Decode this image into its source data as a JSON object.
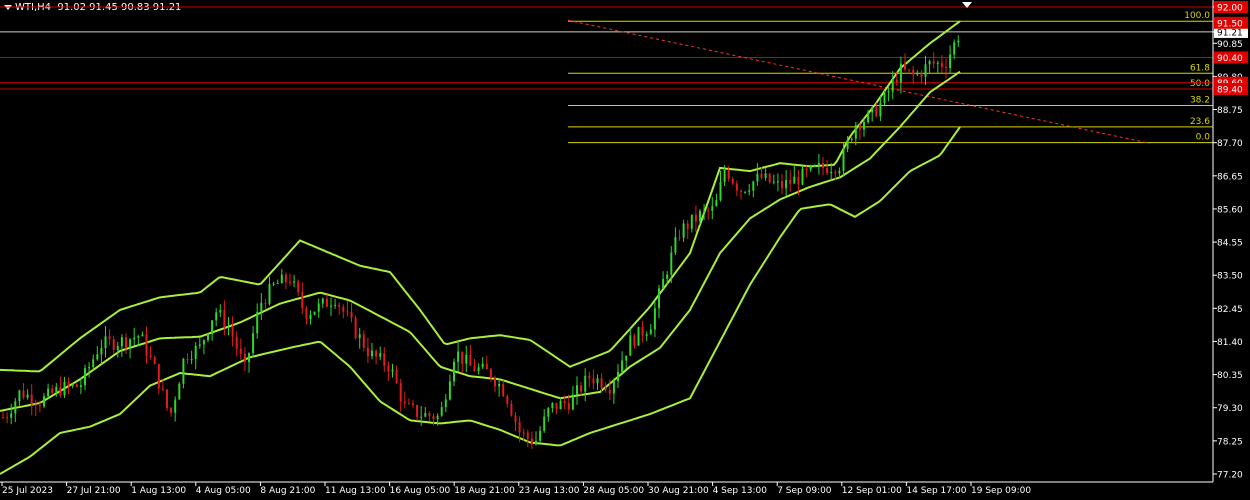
{
  "header": {
    "symbol": "WTI,H4",
    "ohlc": "91.02 91.45 90.83 91.21"
  },
  "chart_data": {
    "type": "candlestick",
    "symbol": "WTI",
    "timeframe": "H4",
    "ylim": [
      76.9,
      92.0
    ],
    "y_ticks": [
      "92.00",
      "91.21",
      "90.85",
      "89.80",
      "88.75",
      "87.70",
      "86.65",
      "85.60",
      "84.55",
      "83.50",
      "82.45",
      "81.40",
      "80.35",
      "79.30",
      "78.25",
      "77.20"
    ],
    "x_ticks": [
      "25 Jul 2023",
      "27 Jul 21:00",
      "1 Aug 13:00",
      "4 Aug 05:00",
      "8 Aug 21:00",
      "11 Aug 13:00",
      "16 Aug 05:00",
      "18 Aug 21:00",
      "23 Aug 13:00",
      "28 Aug 05:00",
      "30 Aug 21:00",
      "4 Sep 13:00",
      "7 Sep 09:00",
      "12 Sep 01:00",
      "14 Sep 17:00",
      "19 Sep 09:00"
    ],
    "current_price": "91.21",
    "red_price_labels": [
      "92.00",
      "91.50",
      "90.40",
      "89.60",
      "89.40"
    ],
    "fibonacci": {
      "levels": [
        {
          "label": "100.0",
          "price": 91.55
        },
        {
          "label": "61.8",
          "price": 89.9
        },
        {
          "label": "50.0",
          "price": 89.4
        },
        {
          "label": "38.2",
          "price": 88.88
        },
        {
          "label": "23.6",
          "price": 88.2
        },
        {
          "label": "0.0",
          "price": 87.7
        }
      ]
    },
    "horizontal_lines": [
      92.0,
      91.21,
      90.4,
      89.6,
      89.4
    ],
    "trendline": {
      "from": [
        568,
        91.58
      ],
      "to": [
        1150,
        87.68
      ]
    },
    "bollinger_bands": {
      "color": "#a8f03c",
      "upper": [
        [
          0,
          80.5
        ],
        [
          40,
          80.45
        ],
        [
          80,
          81.5
        ],
        [
          120,
          82.4
        ],
        [
          160,
          82.8
        ],
        [
          200,
          82.95
        ],
        [
          220,
          83.45
        ],
        [
          260,
          83.2
        ],
        [
          300,
          84.6
        ],
        [
          330,
          84.2
        ],
        [
          360,
          83.8
        ],
        [
          390,
          83.6
        ],
        [
          420,
          82.4
        ],
        [
          445,
          81.3
        ],
        [
          470,
          81.5
        ],
        [
          500,
          81.6
        ],
        [
          530,
          81.45
        ],
        [
          570,
          80.6
        ],
        [
          610,
          81.1
        ],
        [
          650,
          82.5
        ],
        [
          690,
          84.2
        ],
        [
          720,
          86.9
        ],
        [
          750,
          86.8
        ],
        [
          780,
          87.05
        ],
        [
          810,
          86.95
        ],
        [
          835,
          87.0
        ],
        [
          850,
          87.9
        ],
        [
          875,
          88.9
        ],
        [
          900,
          90.05
        ],
        [
          930,
          90.85
        ],
        [
          960,
          91.55
        ]
      ],
      "middle": [
        [
          0,
          79.2
        ],
        [
          40,
          79.45
        ],
        [
          80,
          80.2
        ],
        [
          120,
          81.1
        ],
        [
          160,
          81.5
        ],
        [
          200,
          81.55
        ],
        [
          240,
          82.0
        ],
        [
          280,
          82.6
        ],
        [
          320,
          82.95
        ],
        [
          350,
          82.7
        ],
        [
          380,
          82.2
        ],
        [
          410,
          81.7
        ],
        [
          440,
          80.6
        ],
        [
          470,
          80.3
        ],
        [
          500,
          80.2
        ],
        [
          530,
          79.9
        ],
        [
          560,
          79.6
        ],
        [
          600,
          79.8
        ],
        [
          630,
          80.6
        ],
        [
          660,
          81.2
        ],
        [
          690,
          82.4
        ],
        [
          720,
          84.2
        ],
        [
          750,
          85.3
        ],
        [
          780,
          85.9
        ],
        [
          810,
          86.3
        ],
        [
          840,
          86.6
        ],
        [
          870,
          87.2
        ],
        [
          900,
          88.2
        ],
        [
          930,
          89.3
        ],
        [
          960,
          89.95
        ]
      ],
      "lower": [
        [
          0,
          77.2
        ],
        [
          30,
          77.75
        ],
        [
          60,
          78.5
        ],
        [
          90,
          78.7
        ],
        [
          120,
          79.1
        ],
        [
          150,
          80.0
        ],
        [
          180,
          80.4
        ],
        [
          210,
          80.3
        ],
        [
          250,
          80.9
        ],
        [
          290,
          81.2
        ],
        [
          320,
          81.4
        ],
        [
          350,
          80.6
        ],
        [
          380,
          79.5
        ],
        [
          410,
          78.9
        ],
        [
          440,
          78.8
        ],
        [
          470,
          78.9
        ],
        [
          500,
          78.6
        ],
        [
          530,
          78.2
        ],
        [
          560,
          78.1
        ],
        [
          590,
          78.5
        ],
        [
          620,
          78.8
        ],
        [
          650,
          79.1
        ],
        [
          690,
          79.6
        ],
        [
          720,
          81.4
        ],
        [
          750,
          83.2
        ],
        [
          780,
          84.7
        ],
        [
          800,
          85.6
        ],
        [
          830,
          85.75
        ],
        [
          855,
          85.35
        ],
        [
          880,
          85.85
        ],
        [
          910,
          86.8
        ],
        [
          940,
          87.3
        ],
        [
          960,
          88.2
        ]
      ]
    },
    "price_path": [
      [
        5,
        79.0
      ],
      [
        20,
        79.8
      ],
      [
        40,
        79.5
      ],
      [
        60,
        79.9
      ],
      [
        80,
        80.0
      ],
      [
        100,
        81.3
      ],
      [
        120,
        81.4
      ],
      [
        140,
        81.6
      ],
      [
        155,
        80.5
      ],
      [
        170,
        79.0
      ],
      [
        185,
        81.0
      ],
      [
        200,
        81.2
      ],
      [
        215,
        82.4
      ],
      [
        230,
        81.8
      ],
      [
        245,
        80.5
      ],
      [
        260,
        82.6
      ],
      [
        275,
        83.2
      ],
      [
        290,
        83.4
      ],
      [
        305,
        82.3
      ],
      [
        320,
        82.5
      ],
      [
        335,
        82.8
      ],
      [
        350,
        82.0
      ],
      [
        370,
        81.0
      ],
      [
        390,
        80.6
      ],
      [
        405,
        79.3
      ],
      [
        420,
        79.1
      ],
      [
        440,
        79.0
      ],
      [
        455,
        81.1
      ],
      [
        470,
        80.6
      ],
      [
        490,
        80.4
      ],
      [
        505,
        79.8
      ],
      [
        520,
        78.5
      ],
      [
        535,
        78.2
      ],
      [
        550,
        79.3
      ],
      [
        570,
        79.5
      ],
      [
        590,
        80.3
      ],
      [
        610,
        80.0
      ],
      [
        630,
        81.4
      ],
      [
        650,
        81.9
      ],
      [
        665,
        83.5
      ],
      [
        680,
        84.9
      ],
      [
        700,
        85.4
      ],
      [
        715,
        85.6
      ],
      [
        725,
        86.9
      ],
      [
        740,
        86.2
      ],
      [
        760,
        86.6
      ],
      [
        780,
        86.3
      ],
      [
        800,
        86.6
      ],
      [
        820,
        86.9
      ],
      [
        840,
        87.0
      ],
      [
        855,
        88.3
      ],
      [
        870,
        88.5
      ],
      [
        885,
        89.1
      ],
      [
        900,
        90.0
      ],
      [
        915,
        89.8
      ],
      [
        930,
        90.2
      ],
      [
        945,
        90.2
      ],
      [
        960,
        91.21
      ]
    ]
  }
}
